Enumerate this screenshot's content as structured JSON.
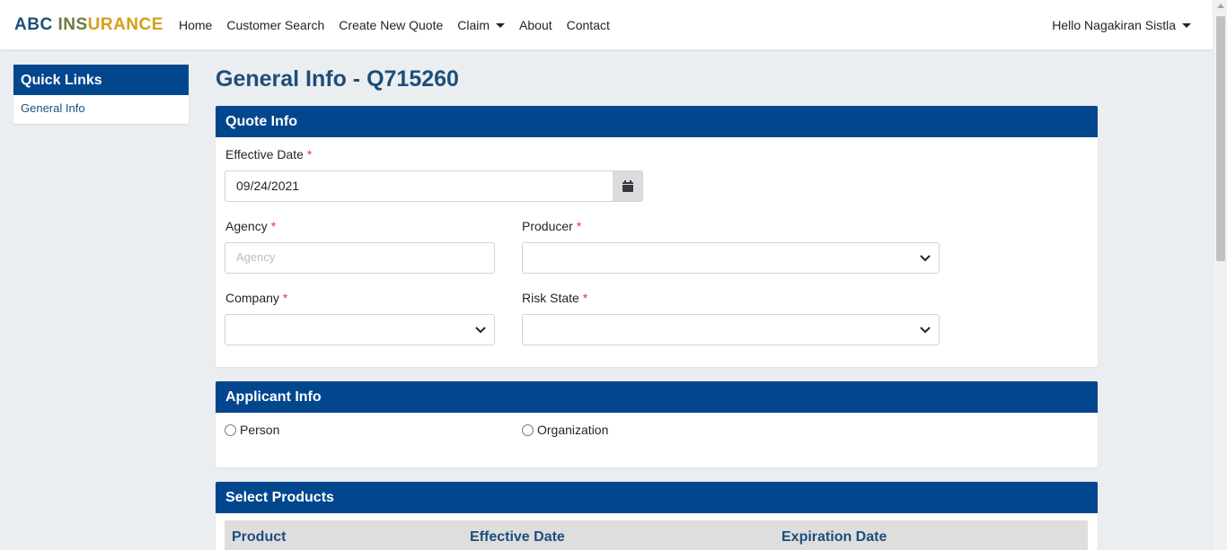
{
  "brand": {
    "part1": "ABC",
    "part2": "INS",
    "part3": "URANCE"
  },
  "nav": {
    "home": "Home",
    "customer_search": "Customer Search",
    "create_quote": "Create New Quote",
    "claim": "Claim",
    "about": "About",
    "contact": "Contact"
  },
  "user": {
    "greeting": "Hello Nagakiran Sistla"
  },
  "sidebar": {
    "title": "Quick Links",
    "items": [
      {
        "label": "General Info"
      }
    ]
  },
  "page": {
    "title": "General Info - Q715260"
  },
  "quote_info": {
    "title": "Quote Info",
    "effective_date_label": "Effective Date",
    "effective_date_value": "09/24/2021",
    "agency_label": "Agency",
    "agency_placeholder": "Agency",
    "producer_label": "Producer",
    "producer_value": "",
    "company_label": "Company",
    "company_value": "",
    "risk_state_label": "Risk State",
    "risk_state_value": "",
    "required_mark": "*"
  },
  "applicant_info": {
    "title": "Applicant Info",
    "options": [
      "Person",
      "Organization"
    ]
  },
  "select_products": {
    "title": "Select Products",
    "columns": [
      "Product",
      "Effective Date",
      "Expiration Date"
    ]
  },
  "icons": {
    "calendar": "calendar-icon",
    "dropdown": "chevron-down-icon",
    "caret": "caret-down-icon"
  },
  "colors": {
    "primary": "#02478d",
    "heading": "#1d4e7a",
    "required": "#dc3545",
    "background": "#ebeef0"
  }
}
